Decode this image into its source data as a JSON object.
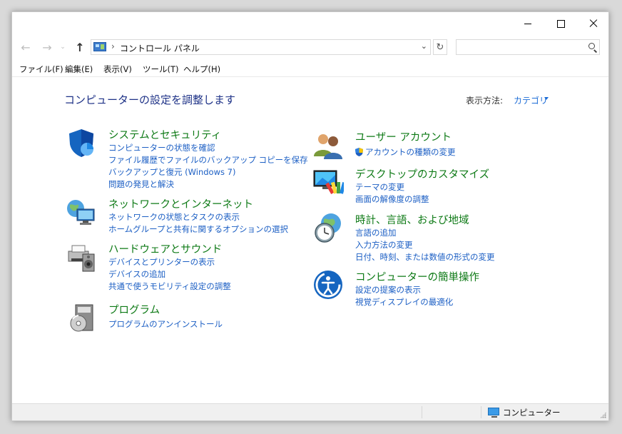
{
  "nav": {
    "back_glyph": "←",
    "forward_glyph": "→",
    "recent_glyph": "⌄",
    "up_glyph": "↑",
    "address": "コントロール パネル",
    "address_separator": "›",
    "dropdown_glyph": "⌄",
    "refresh_glyph": "↻",
    "search_placeholder": ""
  },
  "menu": [
    {
      "label": "ファイル(F)"
    },
    {
      "label": "編集(E)"
    },
    {
      "label": "表示(V)"
    },
    {
      "label": "ツール(T)"
    },
    {
      "label": "ヘルプ(H)"
    }
  ],
  "main": {
    "heading": "コンピューターの設定を調整します",
    "view_by_label": "表示方法:",
    "view_by_value": "カテゴリ"
  },
  "categories_left": [
    {
      "title": "システムとセキュリティ",
      "icon": "shield-icon",
      "links": [
        "コンピューターの状態を確認",
        "ファイル履歴でファイルのバックアップ コピーを保存",
        "バックアップと復元 (Windows 7)",
        "問題の発見と解決"
      ]
    },
    {
      "title": "ネットワークとインターネット",
      "icon": "network-globe-icon",
      "links": [
        "ネットワークの状態とタスクの表示",
        "ホームグループと共有に関するオプションの選択"
      ]
    },
    {
      "title": "ハードウェアとサウンド",
      "icon": "printer-speaker-icon",
      "links": [
        "デバイスとプリンターの表示",
        "デバイスの追加",
        "共通で使うモビリティ設定の調整"
      ]
    },
    {
      "title": "プログラム",
      "icon": "programs-disk-icon",
      "links": [
        "プログラムのアンインストール"
      ]
    }
  ],
  "categories_right": [
    {
      "title": "ユーザー アカウント",
      "icon": "users-icon",
      "links": [
        "アカウントの種類の変更"
      ]
    },
    {
      "title": "デスクトップのカスタマイズ",
      "icon": "display-palette-icon",
      "links": [
        "テーマの変更",
        "画面の解像度の調整"
      ]
    },
    {
      "title": "時計、言語、および地域",
      "icon": "clock-globe-icon",
      "links": [
        "言語の追加",
        "入力方法の変更",
        "日付、時刻、または数値の形式の変更"
      ]
    },
    {
      "title": "コンピューターの簡単操作",
      "icon": "ease-of-access-icon",
      "links": [
        "設定の提案の表示",
        "視覚ディスプレイの最適化"
      ]
    }
  ],
  "status": {
    "text": "コンピューター"
  },
  "colors": {
    "category_title": "#0e7a16",
    "link": "#1c5fc4",
    "heading": "#1e3287"
  }
}
